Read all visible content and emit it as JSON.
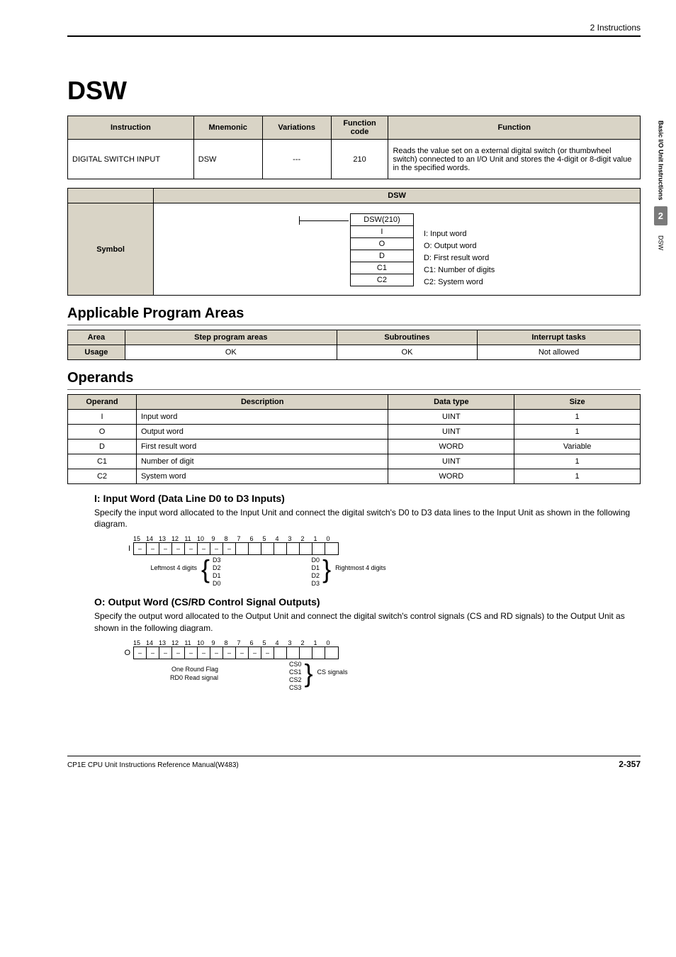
{
  "header": {
    "chapter_label": "2   Instructions"
  },
  "side": {
    "group": "Basic I/O Unit Instructions",
    "chapter_num": "2",
    "instr": "DSW"
  },
  "title": "DSW",
  "instr_table": {
    "headers": [
      "Instruction",
      "Mnemonic",
      "Variations",
      "Function code",
      "Function"
    ],
    "row": {
      "instruction": "DIGITAL SWITCH INPUT",
      "mnemonic": "DSW",
      "variations": "---",
      "code": "210",
      "function": "Reads the value set on a external digital switch (or thumbwheel switch) connected to an I/O Unit and stores the 4-digit or 8-digit value in the specified words."
    }
  },
  "symbol_table": {
    "header": "DSW",
    "rowhead": "Symbol",
    "ladder": {
      "top": "DSW(210)",
      "rows": [
        "I",
        "O",
        "D",
        "C1",
        "C2"
      ],
      "labels": [
        "I: Input word",
        "O: Output word",
        "D: First result word",
        "C1: Number of digits",
        "C2: System word"
      ]
    }
  },
  "areas": {
    "title": "Applicable Program Areas",
    "headers": [
      "Area",
      "Step program areas",
      "Subroutines",
      "Interrupt tasks"
    ],
    "usage_label": "Usage",
    "row": [
      "OK",
      "OK",
      "Not allowed"
    ]
  },
  "operands": {
    "title": "Operands",
    "headers": [
      "Operand",
      "Description",
      "Data type",
      "Size"
    ],
    "rows": [
      {
        "op": "I",
        "desc": "Input word",
        "type": "UINT",
        "size": "1"
      },
      {
        "op": "O",
        "desc": "Output word",
        "type": "UINT",
        "size": "1"
      },
      {
        "op": "D",
        "desc": "First result word",
        "type": "WORD",
        "size": "Variable"
      },
      {
        "op": "C1",
        "desc": "Number of digit",
        "type": "UINT",
        "size": "1"
      },
      {
        "op": "C2",
        "desc": "System word",
        "type": "WORD",
        "size": "1"
      }
    ]
  },
  "input_word": {
    "heading": "I: Input Word (Data Line D0 to D3 Inputs)",
    "body": "Specify the input word allocated to the Input Unit and connect the digital switch's D0 to D3 data lines to the Input Unit as shown in the following diagram.",
    "bit_labels": [
      "15",
      "14",
      "13",
      "12",
      "11",
      "10",
      "9",
      "8",
      "7",
      "6",
      "5",
      "4",
      "3",
      "2",
      "1",
      "0"
    ],
    "cells": [
      "–",
      "–",
      "–",
      "–",
      "–",
      "–",
      "–",
      "–",
      "",
      "",
      "",
      "",
      "",
      "",
      "",
      ""
    ],
    "letter": "I",
    "left_group_label": "Leftmost 4 digits",
    "left_lines": [
      "D3",
      "D2",
      "D1",
      "D0"
    ],
    "right_lines": [
      "D0",
      "D1",
      "D2",
      "D3"
    ],
    "right_group_label": "Rightmost 4 digits"
  },
  "output_word": {
    "heading": "O: Output Word (CS/RD Control Signal Outputs)",
    "body": "Specify the output word allocated to the Output Unit and connect the digital switch's control signals (CS and RD signals) to the Output Unit as shown in the following diagram.",
    "bit_labels": [
      "15",
      "14",
      "13",
      "12",
      "11",
      "10",
      "9",
      "8",
      "7",
      "6",
      "5",
      "4",
      "3",
      "2",
      "1",
      "0"
    ],
    "cells": [
      "–",
      "–",
      "–",
      "–",
      "–",
      "–",
      "–",
      "–",
      "–",
      "–",
      "–",
      "",
      "",
      "",
      "",
      ""
    ],
    "letter": "O",
    "left_lines": [
      "One Round Flag",
      "RD0 Read signal"
    ],
    "right_lines": [
      "CS0",
      "CS1",
      "CS2",
      "CS3"
    ],
    "right_group_label": "CS signals"
  },
  "footer": {
    "manual": "CP1E CPU Unit Instructions Reference Manual(W483)",
    "page": "2-357"
  }
}
